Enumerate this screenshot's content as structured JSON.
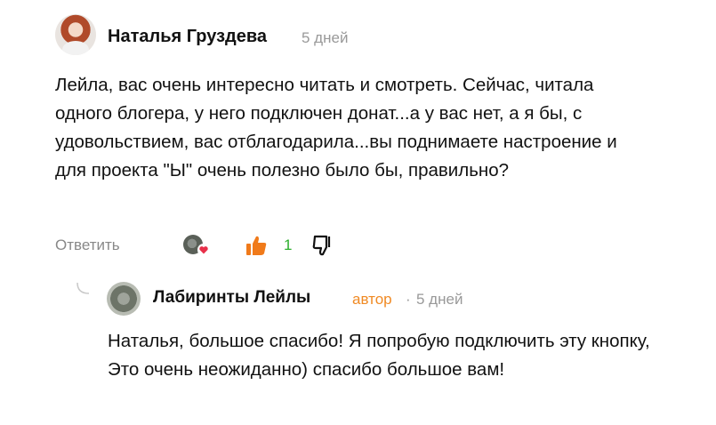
{
  "comment": {
    "author": "Наталья Груздева",
    "time": "5 дней",
    "text": "Лейла, вас очень интересно читать и смотреть. Сейчас, читала одного блогера, у него подключен донат...а у вас нет, а я бы, с удовольствием, вас отблагодарила...вы поднимаете настроение и для проекта \"Ы\" очень полезно было бы, правильно?",
    "reply_label": "Ответить",
    "like_count": "1"
  },
  "reply": {
    "author": "Лабиринты Лейлы",
    "badge": "автор",
    "separator": "·",
    "time": "5 дней",
    "text": "Наталья, большое спасибо! Я попробую подключить эту кнопку, Это очень неожиданно) спасибо большое вам!"
  },
  "colors": {
    "like": "#f07a1a",
    "like_count": "#2bae2b",
    "author_badge": "#f08a24",
    "muted": "#999999"
  },
  "icons": [
    "heart-icon",
    "thumbs-up-icon",
    "thumbs-down-icon",
    "reply-connector-icon"
  ]
}
